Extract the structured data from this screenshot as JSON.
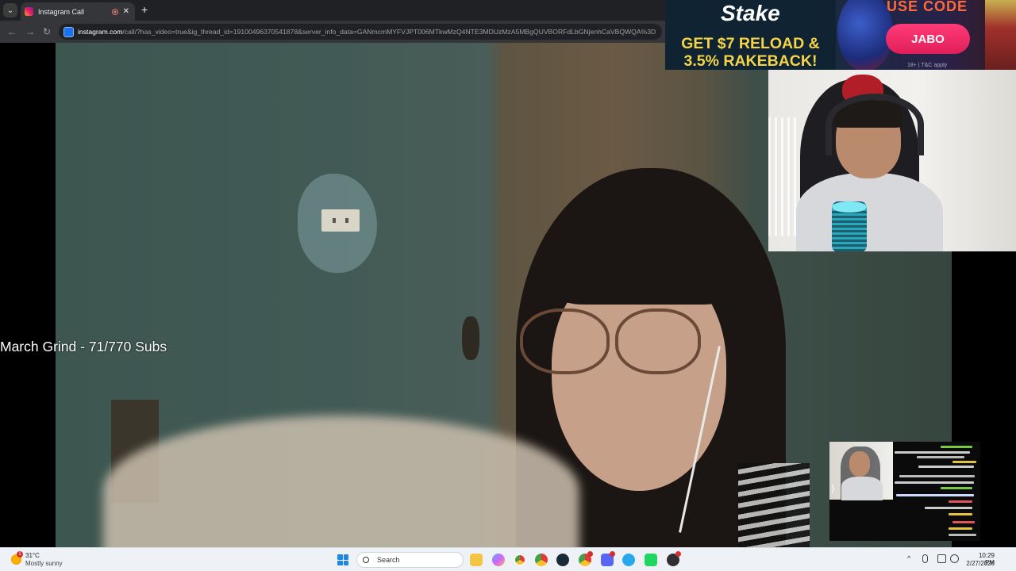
{
  "browser": {
    "tab_title": "Instagram Call",
    "tab_list_glyph": "⌄",
    "tab_close_glyph": "✕",
    "new_tab_glyph": "+",
    "back_glyph": "←",
    "forward_glyph": "→",
    "reload_glyph": "↻",
    "url_host": "instagram.com",
    "url_rest": "/call/?has_video=true&ig_thread_id=19100496370541878&server_info_data=GANmcmMYFVJPT006MTkwMzQ4NTE3MDUzMzA5MBgQUVBORFdLbGNjenhCaVBQWQA%3D"
  },
  "overlay": {
    "goal_text": "March Grind - 71/770 Subs"
  },
  "sponsor": {
    "brand": "Stake",
    "headline_line1": "GET $7 RELOAD &",
    "headline_line2": "3.5% RAKEBACK!",
    "use_code_label": "USE CODE",
    "code": "JABO",
    "disclaimer": "18+ | T&C apply",
    "colors": {
      "headline": "#f5d547",
      "code_button": "#ff3b78",
      "use_code": "#ff6a3d"
    }
  },
  "taskbar": {
    "weather_temp": "31°C",
    "weather_condition": "Mostly sunny",
    "weather_badge": "1",
    "search_placeholder": "Search",
    "time": "10:29 PM",
    "date": "2/27/2026",
    "pinned_icons": [
      "file-explorer-icon",
      "copilot-icon",
      "chrome-icon",
      "chrome-profile-icon",
      "steam-icon",
      "chrome-alt-icon",
      "discord-icon",
      "telegram-icon",
      "spotify-icon",
      "obs-icon"
    ],
    "tray_chevron": "^",
    "tray_icons": [
      "microphone-icon",
      "display-icon",
      "volume-icon"
    ]
  }
}
